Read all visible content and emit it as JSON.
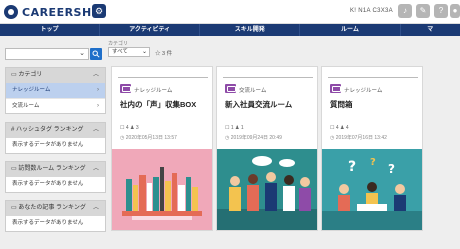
{
  "header": {
    "logo_text": "CAREERSHIP",
    "user_name": "K! N1A C3X3A",
    "icons": [
      "bell-icon",
      "comment-icon",
      "help-icon",
      "user-icon"
    ]
  },
  "nav": {
    "items": [
      "トップ",
      "アクティビティ",
      "スキル開発",
      "ルーム",
      "マ"
    ]
  },
  "search": {
    "placeholder": "",
    "category_label": "カテゴリ",
    "category_value": "すべて",
    "count_text": "☆ 3 件"
  },
  "sidebar": {
    "category": {
      "title": "カテゴリ",
      "items": [
        "ナレッジルーム",
        "交流ルーム"
      ]
    },
    "hashtag": {
      "title": "# ハッシュタグ ランキング",
      "empty": "表示するデータがありません"
    },
    "visited": {
      "title": "訪問数ルーム ランキング",
      "empty": "表示するデータがありません"
    },
    "posts": {
      "title": "あなたの記事 ランキング",
      "empty": "表示するデータがありません"
    }
  },
  "cards": [
    {
      "tag": "ナレッジルーム",
      "title": "社内の「声」収集BOX",
      "meta": "☐ 4   ♟ 3",
      "date": "◷ 2020年05月13日 13:57"
    },
    {
      "tag": "交流ルーム",
      "title": "新入社員交流ルーム",
      "meta": "☐ 1   ♟ 1",
      "date": "◷ 2019年09月24日 20:49"
    },
    {
      "tag": "ナレッジルーム",
      "title": "質問箱",
      "meta": "☐ 4   ♟ 4",
      "date": "◷ 2019年07月16日 13:42"
    }
  ],
  "colors": {
    "brand": "#1b3a74",
    "accent_purple": "#8e4ba8",
    "card1_bg": "#f0a8b9",
    "card2_bg": "#2e8e8e",
    "card3_bg": "#3aa0a8"
  }
}
